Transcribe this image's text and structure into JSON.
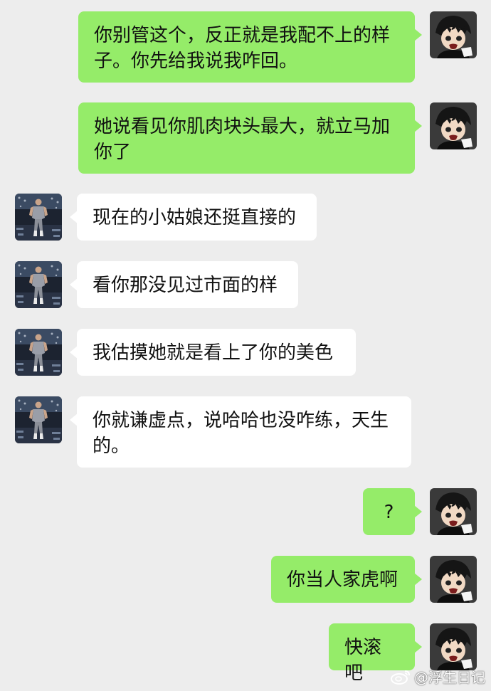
{
  "colors": {
    "background": "#ededed",
    "sent_bubble": "#95ec69",
    "received_bubble": "#ffffff",
    "text": "#111111"
  },
  "messages": [
    {
      "side": "me",
      "text": "你别管这个，反正就是我配不上的样子。你先给我说我咋回。"
    },
    {
      "side": "me",
      "text": "她说看见你肌肉块头最大，就立马加你了"
    },
    {
      "side": "other",
      "text": "现在的小姑娘还挺直接的"
    },
    {
      "side": "other",
      "text": "看你那没见过市面的样"
    },
    {
      "side": "other",
      "text": "我估摸她就是看上了你的美色"
    },
    {
      "side": "other",
      "text": "你就谦虚点，说哈哈也没咋练，天生的。"
    },
    {
      "side": "me",
      "text": "?"
    },
    {
      "side": "me",
      "text": "你当人家虎啊"
    },
    {
      "side": "me",
      "text": "快滚吧"
    }
  ],
  "avatars": {
    "me": "anime-character-avatar",
    "other": "bodybuilder-photo-avatar"
  },
  "watermark": {
    "icon": "weibo-icon",
    "text": "@浮生日记"
  }
}
